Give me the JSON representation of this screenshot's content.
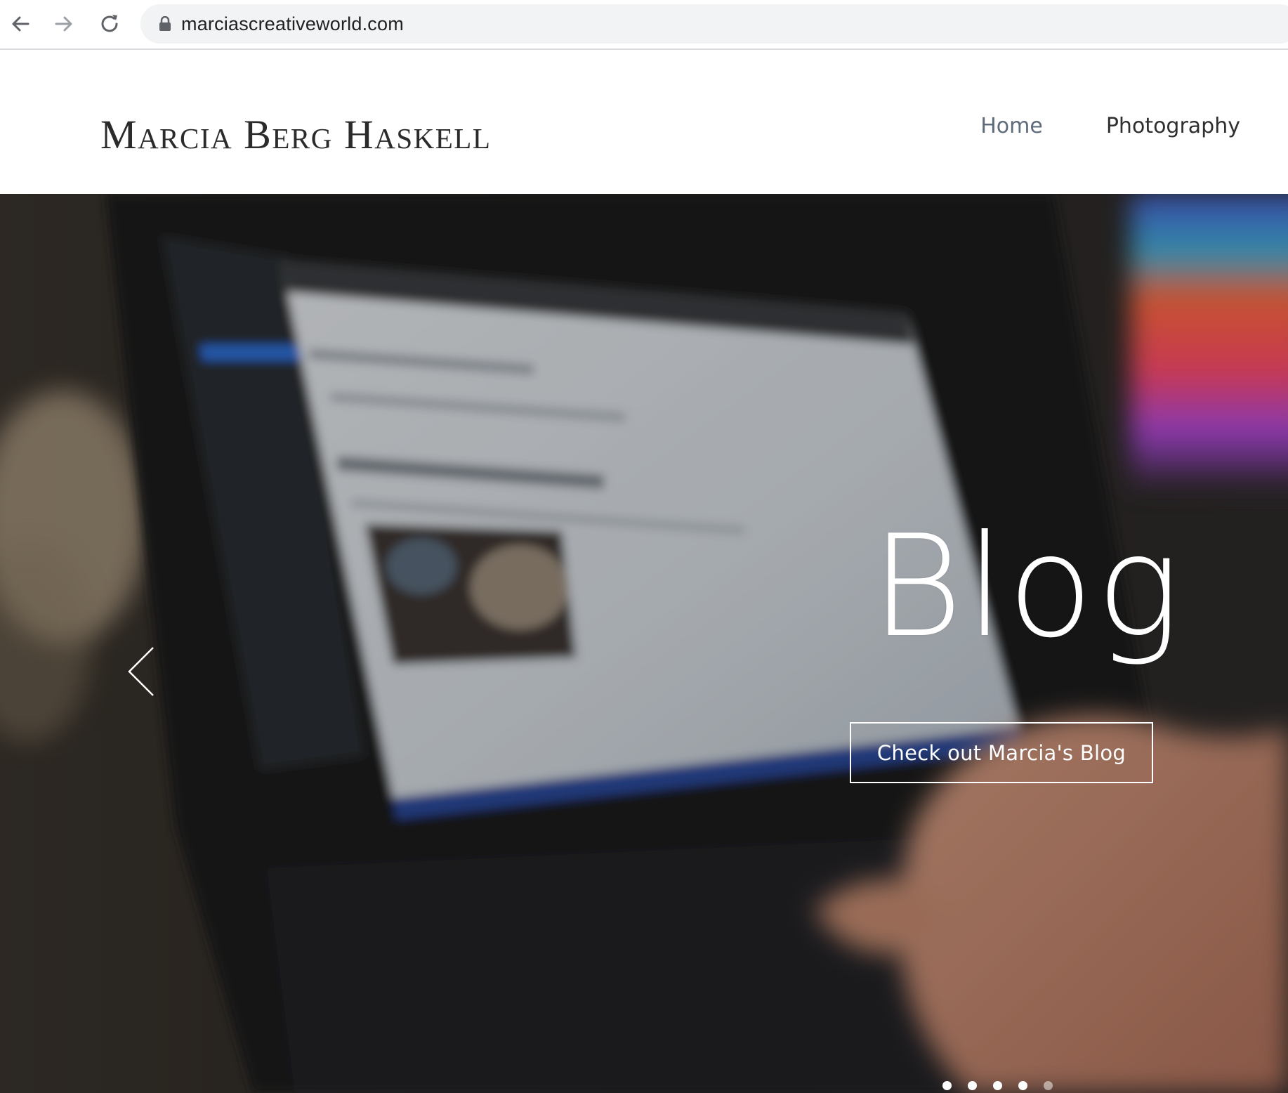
{
  "browser": {
    "url": "marciascreativeworld.com",
    "icons": {
      "back": "arrow-left-icon",
      "forward": "arrow-right-icon",
      "reload": "reload-icon",
      "lock": "lock-icon"
    }
  },
  "header": {
    "logo": "Marcia Berg Haskell",
    "nav": [
      {
        "label": "Home",
        "active": true
      },
      {
        "label": "Photography",
        "active": false
      }
    ]
  },
  "hero": {
    "title": "Blog",
    "cta_label": "Check out Marcia's Blog",
    "prev_icon": "chevron-left-icon",
    "slide_count": 5,
    "active_slide": 5
  },
  "colors": {
    "nav_active": "#5e6b7a",
    "nav_inactive": "#2f2f2f",
    "logo": "#2b2b2b",
    "url_bar_bg": "#f1f3f4"
  }
}
